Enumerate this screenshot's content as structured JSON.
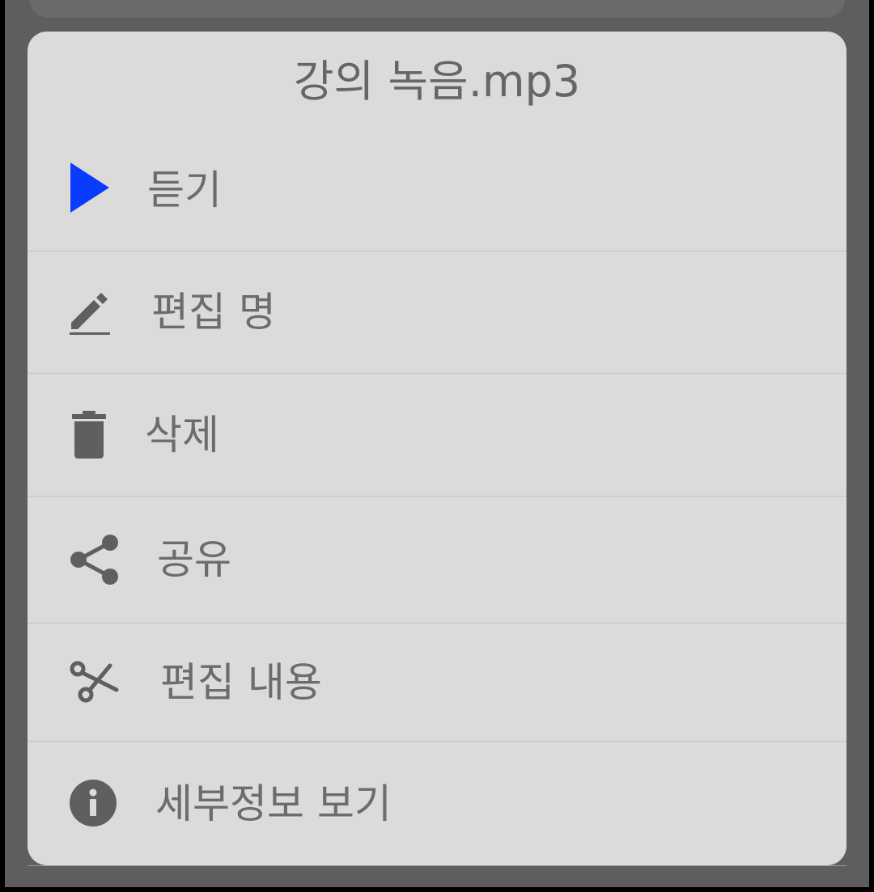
{
  "dialog": {
    "title": "강의 녹음.mp3",
    "items": [
      {
        "label": "듣기",
        "icon": "play-icon"
      },
      {
        "label": "편집 명",
        "icon": "pencil-icon"
      },
      {
        "label": "삭제",
        "icon": "trash-icon"
      },
      {
        "label": "공유",
        "icon": "share-icon"
      },
      {
        "label": "편집 내용",
        "icon": "scissors-icon"
      },
      {
        "label": "세부정보 보기",
        "icon": "info-icon"
      }
    ]
  },
  "colors": {
    "overlay": "#5e5e5e",
    "dialog_background": "#dcdbda",
    "text": "#6c6c6c",
    "icon": "#5f5f5f",
    "play_accent": "#0a3cff",
    "divider": "#c2c1c0"
  }
}
